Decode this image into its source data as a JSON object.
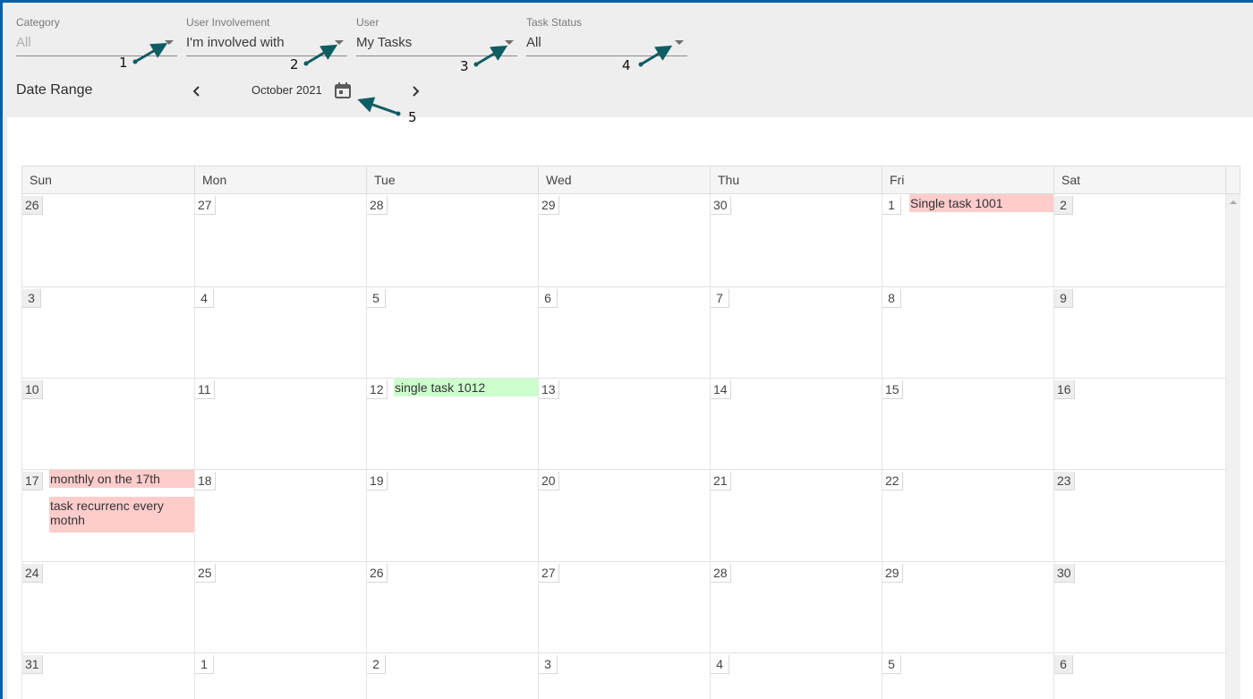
{
  "filters": {
    "category": {
      "label": "Category",
      "value": "All"
    },
    "involvement": {
      "label": "User Involvement",
      "value": "I'm involved with"
    },
    "user": {
      "label": "User",
      "value": "My Tasks"
    },
    "status": {
      "label": "Task Status",
      "value": "All"
    }
  },
  "annotations": [
    "1",
    "2",
    "3",
    "4",
    "5"
  ],
  "date_range": {
    "label": "Date Range",
    "month": "October 2021",
    "prev_icon": "chevron-left-icon",
    "next_icon": "chevron-right-icon",
    "calendar_icon": "calendar-icon"
  },
  "calendar": {
    "weekdays": [
      "Sun",
      "Mon",
      "Tue",
      "Wed",
      "Thu",
      "Fri",
      "Sat"
    ],
    "weeks": [
      [
        "26",
        "27",
        "28",
        "29",
        "30",
        "1",
        "2"
      ],
      [
        "3",
        "4",
        "5",
        "6",
        "7",
        "8",
        "9"
      ],
      [
        "10",
        "11",
        "12",
        "13",
        "14",
        "15",
        "16"
      ],
      [
        "17",
        "18",
        "19",
        "20",
        "21",
        "22",
        "23"
      ],
      [
        "24",
        "25",
        "26",
        "27",
        "28",
        "29",
        "30"
      ],
      [
        "31",
        "1",
        "2",
        "3",
        "4",
        "5",
        "6"
      ]
    ],
    "events": {
      "e1001": "Single task 1001",
      "e1012": "single task 1012",
      "monthly": "monthly on the 17th",
      "recurrence": "task recurrenc every motnh"
    },
    "colors": {
      "red_event": "#ffcccc",
      "green_event": "#ccffcc",
      "annotation_arrow": "#0e5d63"
    }
  }
}
